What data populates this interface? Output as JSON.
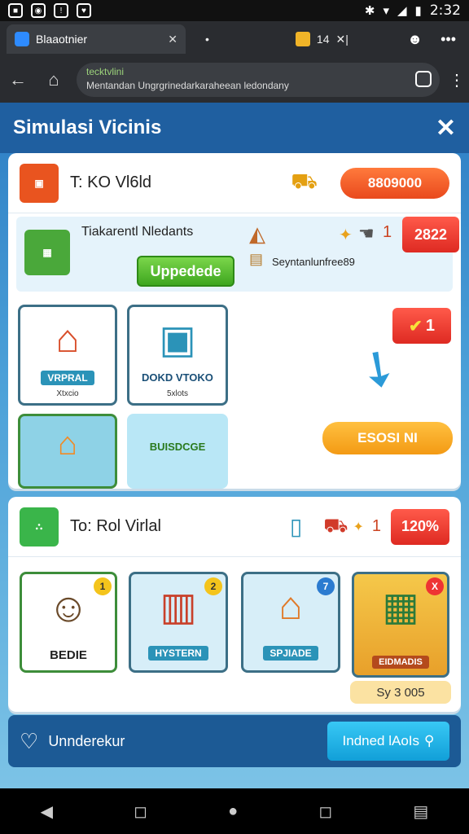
{
  "status": {
    "time": "2:32"
  },
  "browser": {
    "tab_title": "Blaaotnier",
    "tab_counter": "14",
    "url_line1": "tecktvlini",
    "url_line2": "Mentandan Ungrgrinedarkaraheean  ledondany"
  },
  "game": {
    "title": "Simulasi Vicinis",
    "section1": {
      "title": "T: KO Vl6ld",
      "price": "8809000",
      "sub": {
        "name": "Tiakarentl Nledants",
        "upgrade": "Uppedede",
        "subtitle": "Seyntanlunfree89",
        "count": "1",
        "value": "2822"
      },
      "cards": [
        {
          "label": "VRPRAL",
          "sub": "Xtxcio"
        },
        {
          "label": "DOKD VTOKO",
          "sub": "5xlots"
        },
        {
          "label": "",
          "sub": ""
        },
        {
          "label": "BUISDCGE",
          "sub": ""
        }
      ],
      "check_value": "1",
      "orange_button": "ESOSI NI"
    },
    "section2": {
      "title": "To: Rol Virlal",
      "count": "1",
      "percent": "120%",
      "cards": [
        {
          "label": "BEDIE",
          "badge": "1"
        },
        {
          "label": "HYSTERN",
          "badge": "2"
        },
        {
          "label": "SPJIADE",
          "badge": "7"
        },
        {
          "label": "EIDMADIS",
          "badge": "X"
        }
      ],
      "price_tag": "Sy 3 005"
    },
    "bottom": {
      "label": "Unnderekur",
      "button": "Indned lAoIs"
    }
  }
}
